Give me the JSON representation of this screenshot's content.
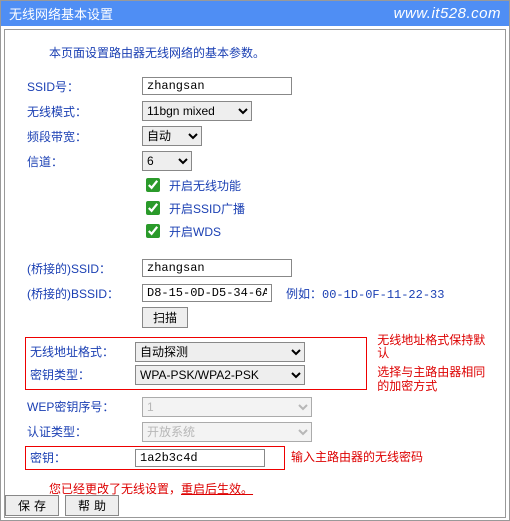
{
  "title": "无线网络基本设置",
  "url_watermark": "www.it528.com",
  "desc": "本页面设置路由器无线网络的基本参数。",
  "fields": {
    "ssid_label": "SSID号：",
    "ssid_value": "zhangsan",
    "mode_label": "无线模式：",
    "mode_value": "11bgn mixed",
    "bandwidth_label": "频段带宽：",
    "bandwidth_value": "自动",
    "channel_label": "信道：",
    "channel_value": "6",
    "cb_wireless": "开启无线功能",
    "cb_ssid_bc": "开启SSID广播",
    "cb_wds": "开启WDS",
    "bridge_ssid_label": "(桥接的)SSID：",
    "bridge_ssid_value": "zhangsan",
    "bridge_bssid_label": "(桥接的)BSSID：",
    "bridge_bssid_value": "D8-15-0D-D5-34-6A",
    "bssid_hint_prefix": "例如：",
    "bssid_hint_example": "00-1D-0F-11-22-33",
    "scan_btn": "扫描",
    "addr_fmt_label": "无线地址格式：",
    "addr_fmt_value": "自动探测",
    "addr_fmt_note": "无线地址格式保持默认",
    "key_type_label": "密钥类型：",
    "key_type_value": "WPA-PSK/WPA2-PSK",
    "key_type_note": "选择与主路由器相同的加密方式",
    "wep_idx_label": "WEP密钥序号：",
    "wep_idx_value": "1",
    "auth_label": "认证类型：",
    "auth_value": "开放系统",
    "key_label": "密钥：",
    "key_value": "1a2b3c4d",
    "key_note": "输入主路由器的无线密码"
  },
  "warn_prefix": "您已经更改了无线设置，",
  "warn_link": "重启后生效。",
  "btn_save": "保存",
  "btn_help": "帮助"
}
